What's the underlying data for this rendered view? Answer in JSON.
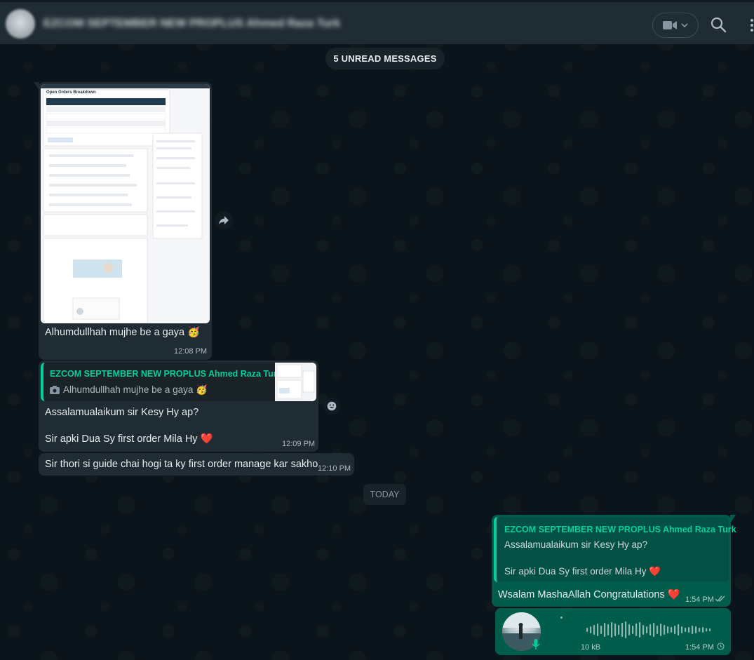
{
  "header": {
    "chat_title": "EZCOM SEPTEMBER NEW PROPLUS Ahmed Raza Turk",
    "icons": [
      "video-call-icon",
      "chevron-down-icon",
      "search-icon",
      "menu-icon"
    ]
  },
  "unread_banner": "5 UNREAD MESSAGES",
  "messages": {
    "image_msg": {
      "caption": "Alhumdullhah mujhe be a gaya 🥳",
      "time": "12:08 PM",
      "screenshot_title": "Open Orders Breakdown"
    },
    "reply_msg": {
      "quote_author": "EZCOM SEPTEMBER NEW PROPLUS Ahmed Raza Turk",
      "quote_text": "Alhumdullhah mujhe be a gaya 🥳",
      "line1": "Assalamualaikum sir Kesy Hy ap?",
      "line2": "Sir apki Dua Sy first order Mila Hy ❤️",
      "time": "12:09 PM"
    },
    "simple_msg": {
      "text": "Sir thori si guide chai hogi ta ky first order manage kar sakho",
      "time": "12:10 PM"
    },
    "date_divider": "TODAY",
    "out_reply_msg": {
      "quote_author": "EZCOM SEPTEMBER NEW PROPLUS Ahmed Raza Turk",
      "quote_line1": "Assalamualaikum sir Kesy Hy ap?",
      "quote_line2": "Sir apki Dua Sy first order Mila Hy ❤️",
      "text": "Wsalam MashaAllah Congratulations ❤️",
      "time": "1:54 PM"
    },
    "voice_msg": {
      "size": "10 kB",
      "time": "1:54 PM"
    }
  },
  "colors": {
    "incoming_bubble": "#202c33",
    "outgoing_bubble": "#005c4b",
    "accent_green": "#06cf9c",
    "background": "#0b141a"
  }
}
